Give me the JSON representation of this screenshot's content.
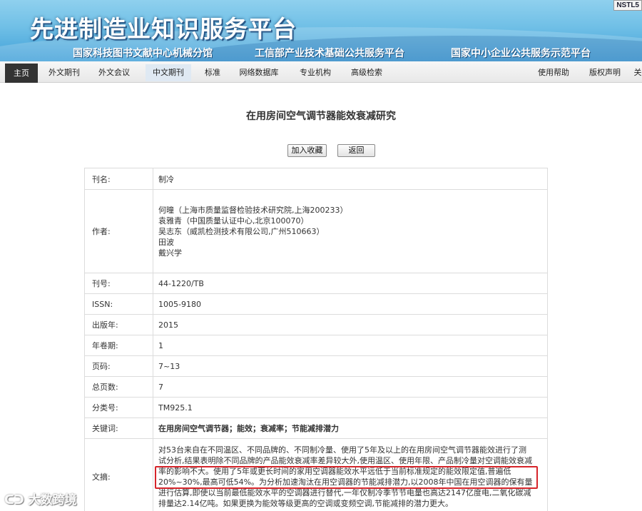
{
  "banner": {
    "title": "先进制造业知识服务平台",
    "subtitles": [
      "国家科技图书文献中心机械分馆",
      "工信部产业技术基础公共服务平台",
      "国家中小企业公共服务示范平台"
    ],
    "badge": "NSTL5"
  },
  "nav": {
    "items": [
      {
        "label": "主页"
      },
      {
        "label": "外文期刊"
      },
      {
        "label": "外文会议"
      },
      {
        "label": "中文期刊"
      },
      {
        "label": "标准"
      },
      {
        "label": "网络数据库"
      },
      {
        "label": "专业机构"
      },
      {
        "label": "高级检索"
      }
    ],
    "right_items": [
      {
        "label": "使用帮助"
      },
      {
        "label": "版权声明"
      },
      {
        "label": "关"
      }
    ]
  },
  "article": {
    "title": "在用房间空气调节器能效衰减研究",
    "add_favorite_label": "加入收藏",
    "back_label": "返回"
  },
  "fields": {
    "journal": {
      "label": "刊名:",
      "value": "制冷"
    },
    "authors": {
      "label": "作者:",
      "lines": [
        "何曈（上海市质量监督检验技术研究院,上海200233）",
        "袁雅青（中国质量认证中心,北京100070）",
        "吴志东（威凯检测技术有限公司,广州510663）",
        "田波",
        "戴兴学"
      ]
    },
    "issn_code": {
      "label": "刊号:",
      "value": "44-1220/TB"
    },
    "issn": {
      "label": "ISSN:",
      "value": "1005-9180"
    },
    "year": {
      "label": "出版年:",
      "value": "2015"
    },
    "volume": {
      "label": "年卷期:",
      "value": "1"
    },
    "pages": {
      "label": "页码:",
      "value": "7~13"
    },
    "total_pages": {
      "label": "总页数:",
      "value": "7"
    },
    "classification": {
      "label": "分类号:",
      "value": "TM925.1"
    },
    "keywords": {
      "label": "关键词:",
      "value": "在用房间空气调节器；能效；衰减率；节能减排潜力"
    },
    "abstract": {
      "label": "文摘:",
      "lines": [
        "对53台来自在不同温区、不同品牌的、不同制冷量、使用了5年及以上的在用房间空气调节器能效进行了测",
        "试分析,结果表明除不同品牌的产品能效衰减率差异较大外,使用温区、使用年限、产品制冷量对空调能效衰减",
        "率的影响不大。使用了5年或更长时间的家用空调器能效水平远低于当前标准规定的能效限定值,普遍低",
        "20%~30%,最高可低54%。为分析加速淘汰在用空调器的节能减排潜力,以2008年中国在用空调器的保有量",
        "进行估算,即使以当前最低能效水平的空调器进行替代,一年仅制冷季节节电量也高达2147亿度电,二氧化碳减",
        "排量达2.14亿吨。如果更换为能效等级更高的空调或变频空调,节能减排的潜力更大。"
      ]
    }
  },
  "watermark": "大数跨境"
}
